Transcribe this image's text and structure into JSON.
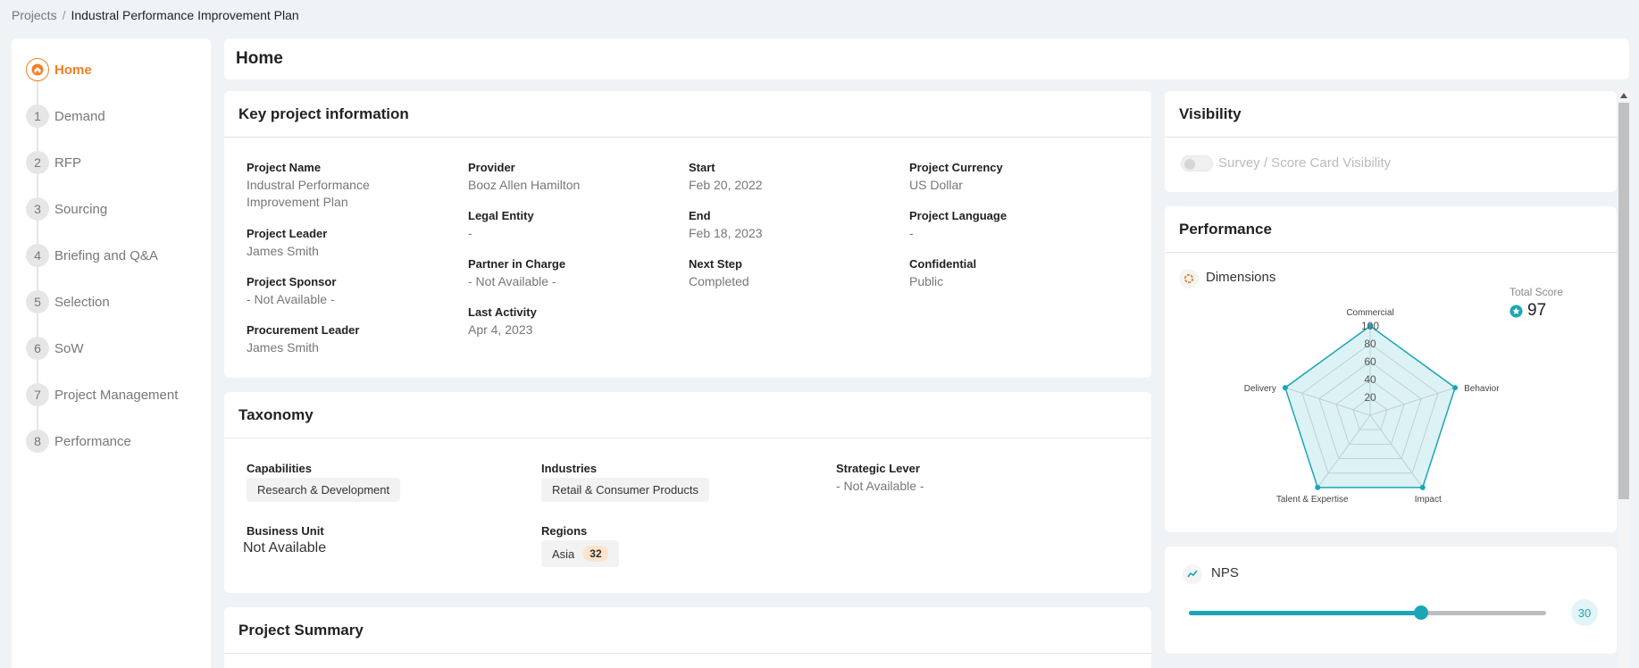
{
  "breadcrumb": {
    "root": "Projects",
    "separator": "/",
    "current": "Industral Performance Improvement Plan"
  },
  "sidebar": {
    "items": [
      {
        "num": "",
        "label": "Home",
        "active": true
      },
      {
        "num": "1",
        "label": "Demand"
      },
      {
        "num": "2",
        "label": "RFP"
      },
      {
        "num": "3",
        "label": "Sourcing"
      },
      {
        "num": "4",
        "label": "Briefing and Q&A"
      },
      {
        "num": "5",
        "label": "Selection"
      },
      {
        "num": "6",
        "label": "SoW"
      },
      {
        "num": "7",
        "label": "Project Management"
      },
      {
        "num": "8",
        "label": "Performance"
      }
    ]
  },
  "page": {
    "title": "Home"
  },
  "key_info": {
    "title": "Key project information",
    "project_name_label": "Project Name",
    "project_name": "Industral Performance Improvement Plan",
    "project_leader_label": "Project Leader",
    "project_leader": "James Smith",
    "project_sponsor_label": "Project Sponsor",
    "project_sponsor": "- Not Available -",
    "procurement_leader_label": "Procurement Leader",
    "procurement_leader": "James Smith",
    "provider_label": "Provider",
    "provider": "Booz Allen Hamilton",
    "legal_entity_label": "Legal Entity",
    "legal_entity": "-",
    "partner_label": "Partner in Charge",
    "partner": "- Not Available -",
    "last_activity_label": "Last Activity",
    "last_activity": "Apr 4, 2023",
    "start_label": "Start",
    "start": "Feb 20, 2022",
    "end_label": "End",
    "end": "Feb 18, 2023",
    "next_step_label": "Next Step",
    "next_step": "Completed",
    "currency_label": "Project Currency",
    "currency": "US Dollar",
    "language_label": "Project Language",
    "language": "-",
    "confidential_label": "Confidential",
    "confidential": "Public"
  },
  "taxonomy": {
    "title": "Taxonomy",
    "capabilities_label": "Capabilities",
    "capabilities": "Research & Development",
    "industries_label": "Industries",
    "industries": "Retail & Consumer Products",
    "strategic_label": "Strategic Lever",
    "strategic": "- Not Available -",
    "business_unit_label": "Business Unit",
    "business_unit": "Not Available",
    "regions_label": "Regions",
    "region": "Asia",
    "region_count": "32"
  },
  "summary": {
    "title": "Project Summary"
  },
  "visibility": {
    "title": "Visibility",
    "toggle_label": "Survey / Score Card Visibility",
    "enabled": false
  },
  "performance": {
    "title": "Performance",
    "dimensions_label": "Dimensions",
    "total_score_label": "Total Score",
    "total_score": "97",
    "accent_color": "#1aa6b7"
  },
  "chart_data": {
    "type": "radar",
    "categories": [
      "Commercial",
      "Behavior",
      "Impact",
      "Talent & Expertise",
      "Delivery"
    ],
    "values": [
      100,
      100,
      100,
      100,
      100
    ],
    "ticks": [
      "20",
      "40",
      "60",
      "80",
      "100"
    ],
    "rlim": [
      0,
      100
    ],
    "grid": true
  },
  "nps": {
    "label": "NPS",
    "value": "30",
    "fraction": 0.65
  }
}
